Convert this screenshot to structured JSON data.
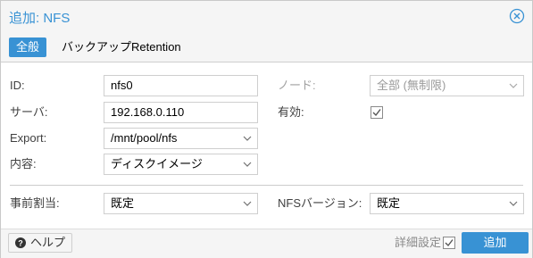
{
  "dialog": {
    "title": "追加: NFS",
    "close_icon": "close-circle-icon"
  },
  "tabs": [
    {
      "label": "全般",
      "active": true
    },
    {
      "label": "バックアップRetention",
      "active": false
    }
  ],
  "form": {
    "id": {
      "label": "ID:",
      "value": "nfs0"
    },
    "server": {
      "label": "サーバ:",
      "value": "192.168.0.110"
    },
    "export": {
      "label": "Export:",
      "value": "/mnt/pool/nfs"
    },
    "content": {
      "label": "内容:",
      "value": "ディスクイメージ"
    },
    "node": {
      "label": "ノード:",
      "value": "全部 (無制限)"
    },
    "enabled": {
      "label": "有効:",
      "checked": true
    },
    "preallocation": {
      "label": "事前割当:",
      "value": "既定"
    },
    "nfs_version": {
      "label": "NFSバージョン:",
      "value": "既定"
    }
  },
  "footer": {
    "help_label": "ヘルプ",
    "help_icon": "question-circle-icon",
    "advanced_label": "詳細設定",
    "advanced_checked": true,
    "add_label": "追加"
  },
  "colors": {
    "accent": "#3892d4",
    "header_bg": "#f5f5f5",
    "border": "#cfcfcf"
  }
}
